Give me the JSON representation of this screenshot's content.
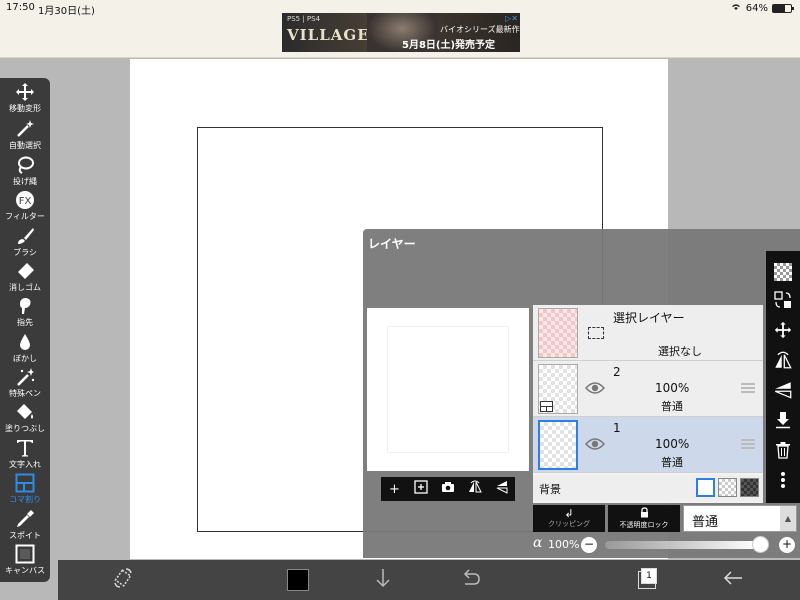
{
  "status_bar": {
    "time": "17:50",
    "date": "1月30日(土)",
    "battery": "64%",
    "battery_level": 0.64
  },
  "ad": {
    "platforms": "PS5 | PS4",
    "title": "VILLAGE",
    "line1": "バイオシリーズ最新作",
    "line2": "5月8日(土)発売予定"
  },
  "left_toolbar": {
    "tools": [
      {
        "icon": "move-icon",
        "label": "移動変形"
      },
      {
        "icon": "magic-wand-icon",
        "label": "自動選択"
      },
      {
        "icon": "lasso-icon",
        "label": "投げ縄"
      },
      {
        "icon": "fx-icon",
        "label": "フィルター"
      },
      {
        "icon": "brush-icon",
        "label": "ブラシ"
      },
      {
        "icon": "eraser-icon",
        "label": "消しゴム"
      },
      {
        "icon": "finger-icon",
        "label": "指先"
      },
      {
        "icon": "blur-drop-icon",
        "label": "ぼかし"
      },
      {
        "icon": "special-pen-icon",
        "label": "特殊ペン"
      },
      {
        "icon": "fill-bucket-icon",
        "label": "塗りつぶし"
      },
      {
        "icon": "text-icon",
        "label": "文字入れ"
      },
      {
        "icon": "frame-divider-icon",
        "label": "コマ割り"
      },
      {
        "icon": "eyedropper-icon",
        "label": "スポイト"
      },
      {
        "icon": "canvas-icon",
        "label": "キャンバス"
      }
    ],
    "active_tool": "コマ割り",
    "active_color": "#2f8ce6"
  },
  "layer_panel": {
    "title": "レイヤー",
    "layers": [
      {
        "name": "選択レイヤー",
        "status": "選択なし",
        "type": "selection"
      },
      {
        "name": "2",
        "opacity": "100%",
        "mode": "普通",
        "selected": false
      },
      {
        "name": "1",
        "opacity": "100%",
        "mode": "普通",
        "selected": true
      }
    ],
    "background_label": "背景",
    "clipping_label": "クリッピング",
    "opacity_lock_label": "不透明度ロック",
    "blend_mode": "普通",
    "alpha_symbol": "α",
    "alpha_value": "100%",
    "alpha_fraction": 1.0
  },
  "bottom_toolbar": {
    "page_count": "1",
    "current_color": "#000000"
  },
  "colors": {
    "selected_layer_bg": "#cdd9ea",
    "accent": "#2f7fe0"
  }
}
